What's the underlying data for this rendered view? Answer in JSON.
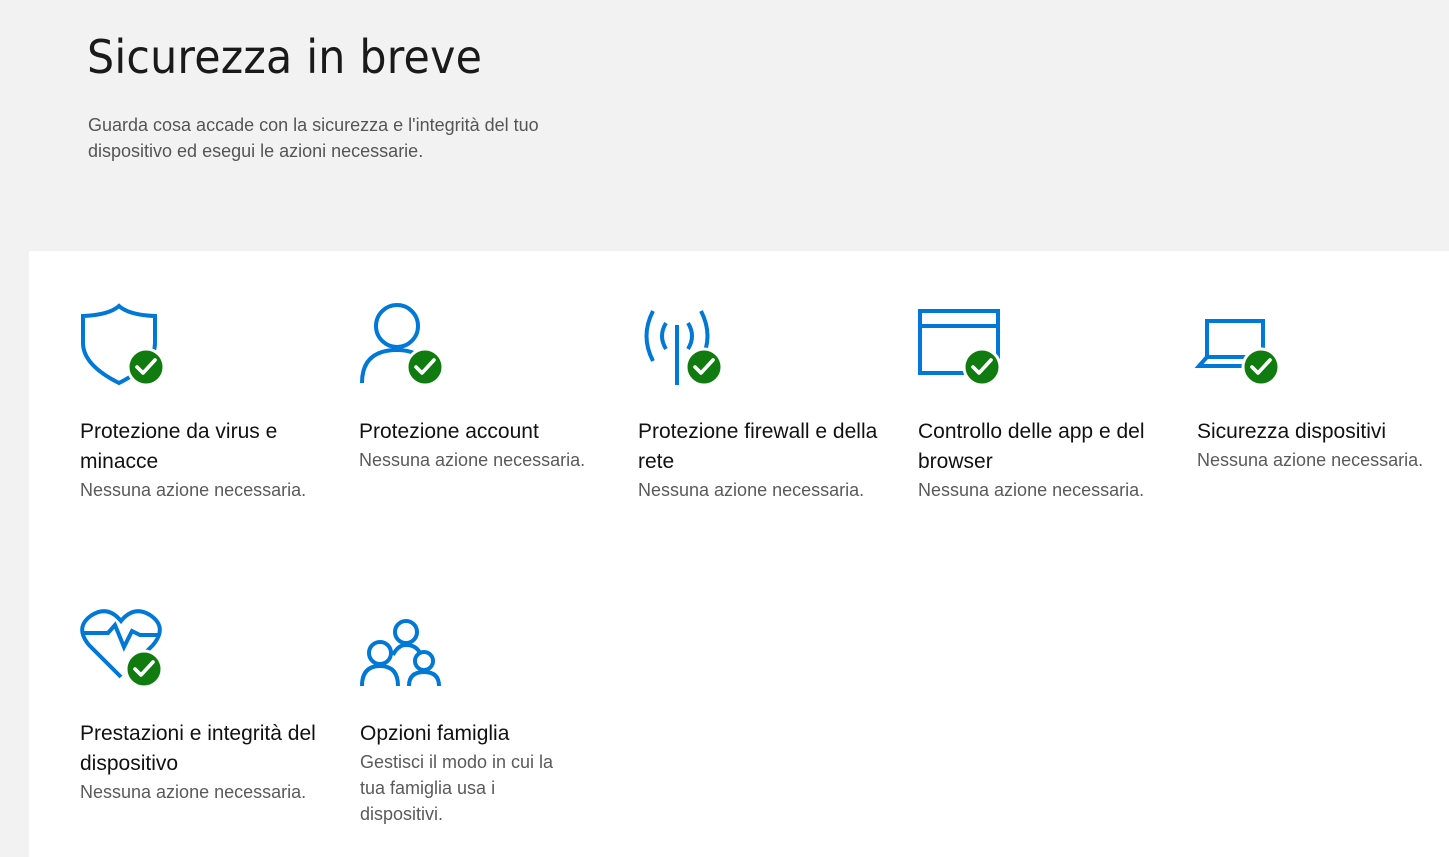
{
  "header": {
    "title": "Sicurezza in breve",
    "subtitle": "Guarda cosa accade con la sicurezza e l'integrità del tuo dispositivo ed esegui le azioni necessarie."
  },
  "colors": {
    "accent": "#0078d7",
    "ok": "#107c10"
  },
  "tiles": [
    {
      "title": "Protezione da virus e minacce",
      "status": "Nessuna azione necessaria.",
      "icon": "shield-icon",
      "ok": true
    },
    {
      "title": "Protezione account",
      "status": "Nessuna azione necessaria.",
      "icon": "person-icon",
      "ok": true
    },
    {
      "title": "Protezione firewall e della rete",
      "status": "Nessuna azione necessaria.",
      "icon": "wifi-antenna-icon",
      "ok": true
    },
    {
      "title": "Controllo delle app e del browser",
      "status": "Nessuna azione necessaria.",
      "icon": "browser-window-icon",
      "ok": true
    },
    {
      "title": "Sicurezza dispositivi",
      "status": "Nessuna azione necessaria.",
      "icon": "laptop-icon",
      "ok": true
    },
    {
      "title": "Prestazioni e integrità del dispositivo",
      "status": "Nessuna azione necessaria.",
      "icon": "heart-pulse-icon",
      "ok": true
    },
    {
      "title": "Opzioni famiglia",
      "status": "Gestisci il modo in cui la tua famiglia usa i dispositivi.",
      "icon": "family-icon",
      "ok": false
    }
  ]
}
